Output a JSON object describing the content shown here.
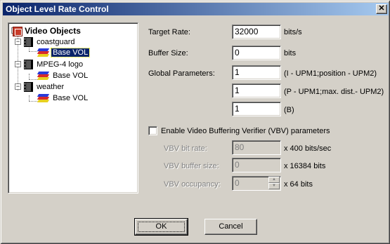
{
  "window": {
    "title": "Object Level Rate Control",
    "close_glyph": "✕"
  },
  "tree": {
    "root": {
      "label": "Video Objects",
      "icon": "video-objects-icon"
    },
    "objects": [
      {
        "label": "coastguard",
        "icon": "film-strip-icon",
        "child": {
          "label": "Base VOL",
          "icon": "layers-icon",
          "selected": true
        }
      },
      {
        "label": "MPEG-4 logo",
        "icon": "film-strip-icon",
        "child": {
          "label": "Base VOL",
          "icon": "layers-icon",
          "selected": false
        }
      },
      {
        "label": "weather",
        "icon": "film-strip-icon",
        "child": {
          "label": "Base VOL",
          "icon": "layers-icon",
          "selected": false
        }
      }
    ],
    "expander_glyph": "−",
    "selection_color": "#0a246a"
  },
  "form": {
    "target_rate": {
      "label": "Target Rate:",
      "value": "32000",
      "unit": "bits/s"
    },
    "buffer_size": {
      "label": "Buffer Size:",
      "value": "0",
      "unit": "bits"
    },
    "global_parameters": {
      "label": "Global Parameters:",
      "rows": [
        {
          "value": "1",
          "note": "(I - UPM1;position - UPM2)"
        },
        {
          "value": "1",
          "note": "(P - UPM1;max. dist.- UPM2)"
        },
        {
          "value": "1",
          "note": "(B)"
        }
      ]
    },
    "vbv": {
      "checkbox_label": "Enable Video Buffering Verifier (VBV) parameters",
      "checked": false,
      "bit_rate": {
        "label": "VBV bit rate:",
        "value": "80",
        "unit": "x 400 bits/sec"
      },
      "buffer_size": {
        "label": "VBV buffer size:",
        "value": "0",
        "unit": "x 16384 bits"
      },
      "occupancy": {
        "label": "VBV occupancy:",
        "value": "0",
        "unit": "x 64 bits"
      }
    }
  },
  "buttons": {
    "ok": "OK",
    "cancel": "Cancel"
  },
  "colors": {
    "title_start": "#0a246a",
    "title_end": "#a6caf0",
    "face": "#d4d0c8"
  }
}
